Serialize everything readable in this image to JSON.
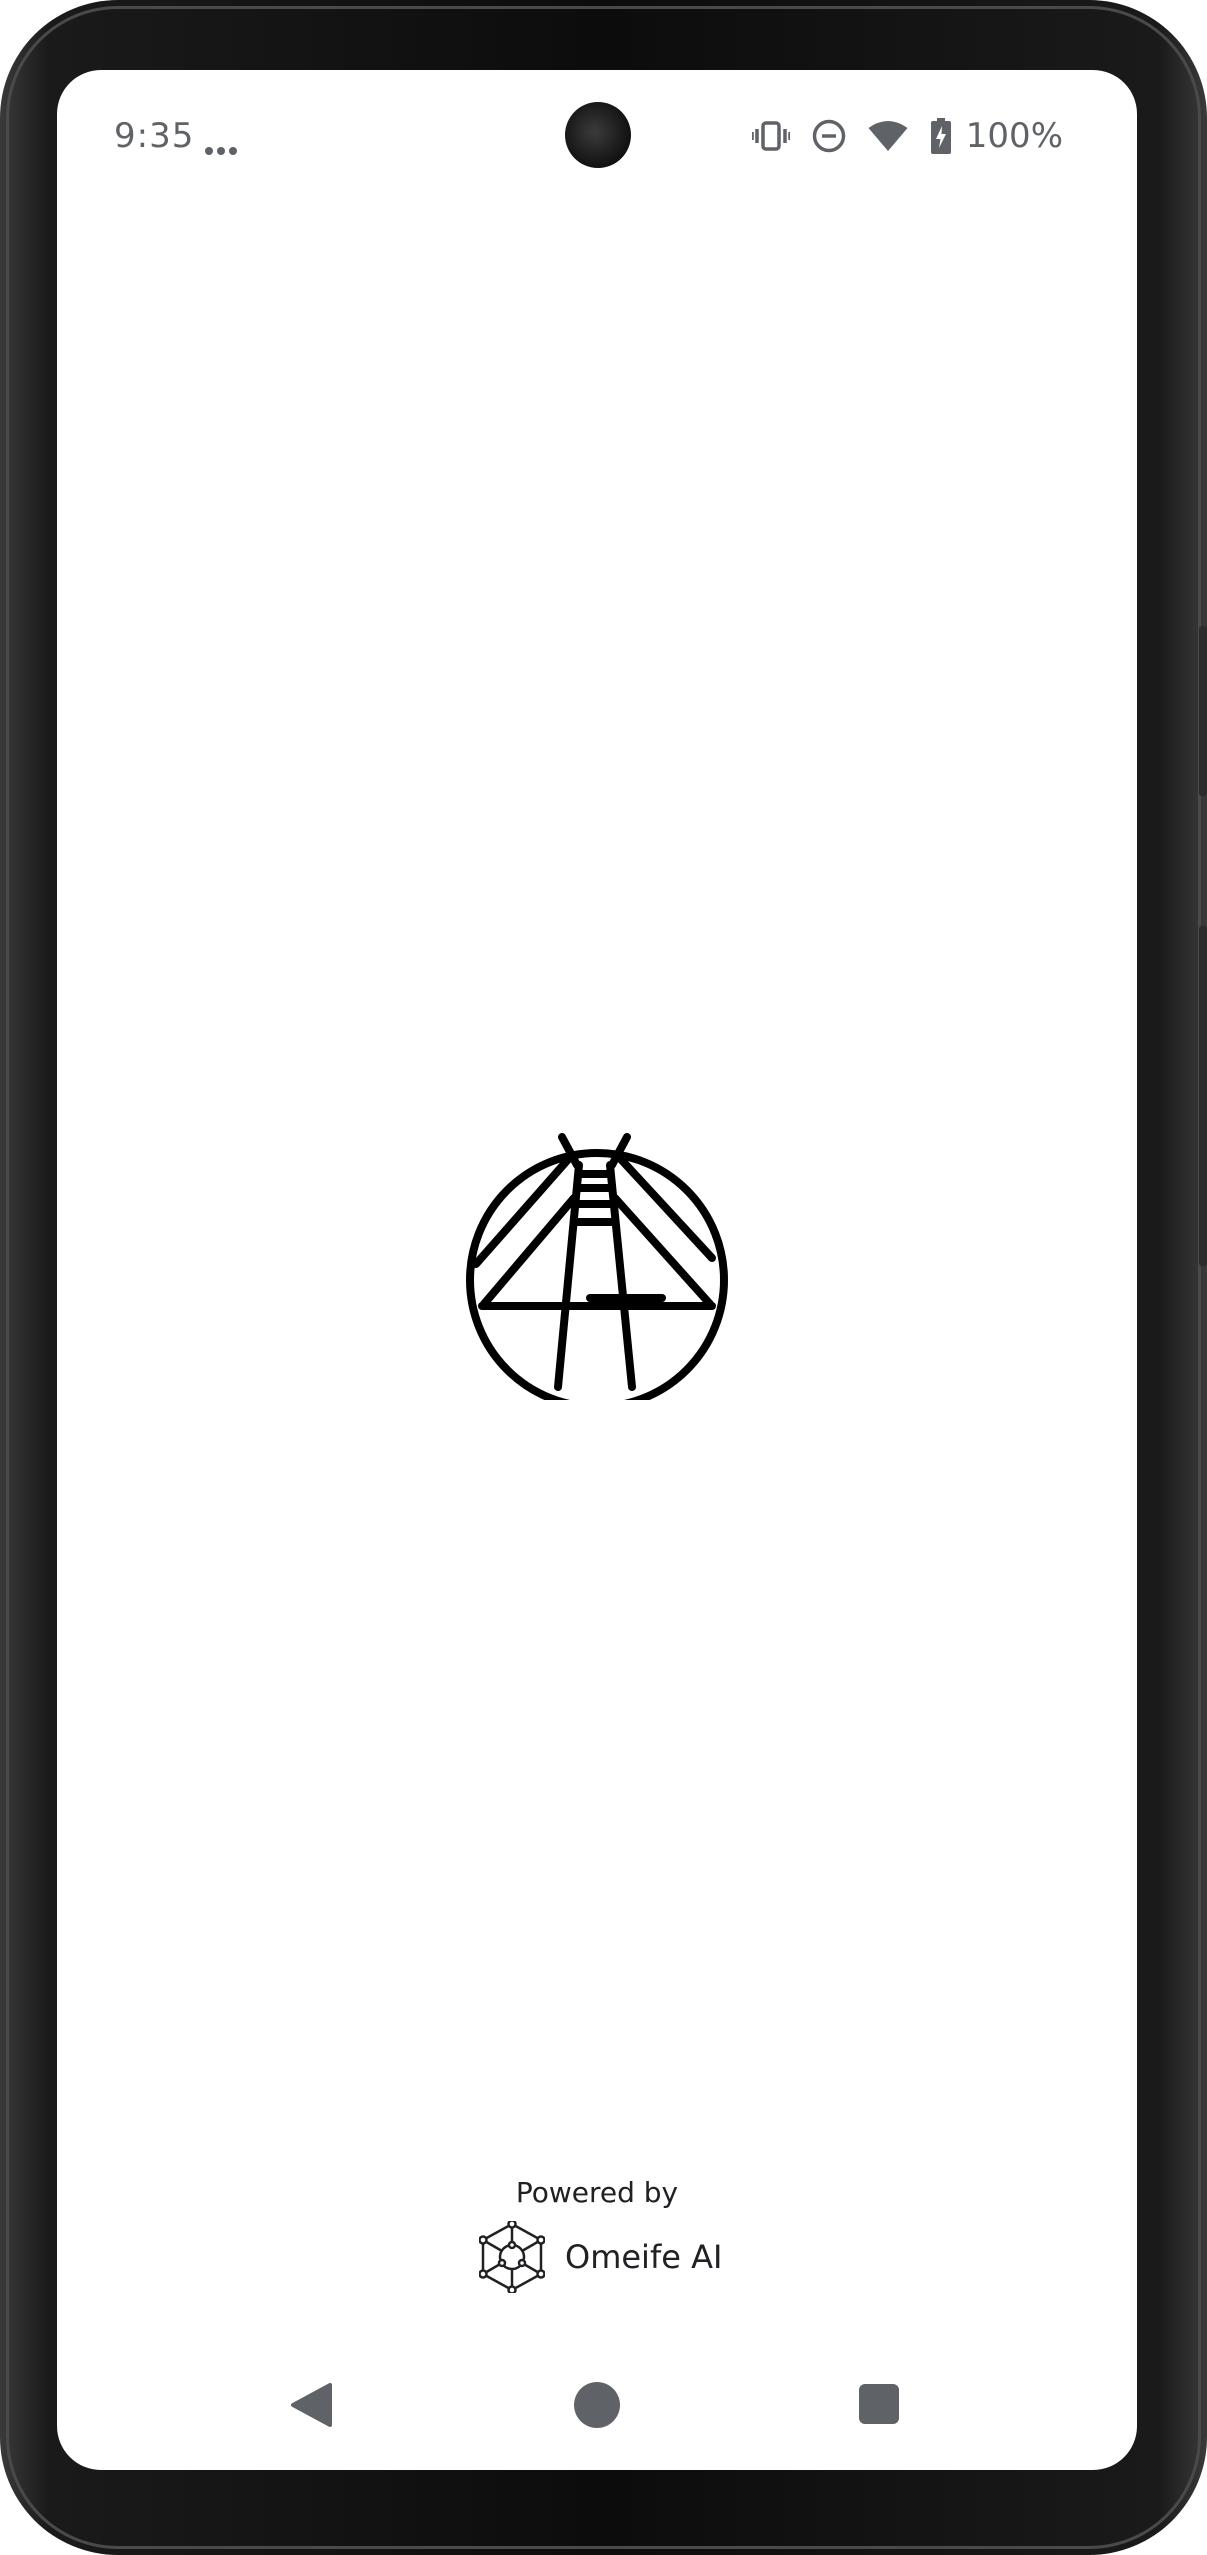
{
  "status_bar": {
    "time": "9:35",
    "battery_percent": "100%",
    "icons": [
      "more-notifications-icon",
      "vibrate-icon",
      "do-not-disturb-icon",
      "wifi-icon",
      "battery-charging-icon"
    ]
  },
  "splash": {
    "logo_icon": "app-logo-icon",
    "powered_by_label": "Powered by",
    "partner_name": "Omeife AI",
    "partner_icon": "omeife-ai-logo-icon"
  },
  "nav_bar": {
    "buttons": [
      "back-icon",
      "home-icon",
      "recents-icon"
    ]
  },
  "colors": {
    "screen_background": "#ffffff",
    "system_icon": "#5f6368",
    "text": "#202124",
    "logo": "#000000",
    "frame": "#0c0c0c"
  }
}
